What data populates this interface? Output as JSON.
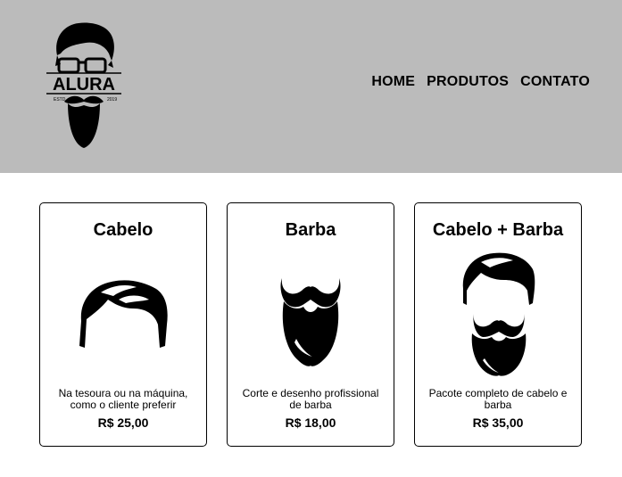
{
  "header": {
    "logo": {
      "brand_text": "ALURA",
      "left_text": "ESTD",
      "right_text": "2019"
    },
    "nav": [
      {
        "label": "HOME"
      },
      {
        "label": "PRODUTOS"
      },
      {
        "label": "CONTATO"
      }
    ]
  },
  "products": [
    {
      "title": "Cabelo",
      "icon": "hair-icon",
      "description": "Na tesoura ou na máquina, como o cliente preferir",
      "price": "R$ 25,00"
    },
    {
      "title": "Barba",
      "icon": "beard-icon",
      "description": "Corte e desenho profissional de barba",
      "price": "R$ 18,00"
    },
    {
      "title": "Cabelo + Barba",
      "icon": "hair-and-beard-icon",
      "description": "Pacote completo de cabelo e barba",
      "price": "R$ 35,00"
    }
  ],
  "colors": {
    "header_bg": "#bbbbbb",
    "text": "#000000",
    "card_border": "#000000"
  }
}
